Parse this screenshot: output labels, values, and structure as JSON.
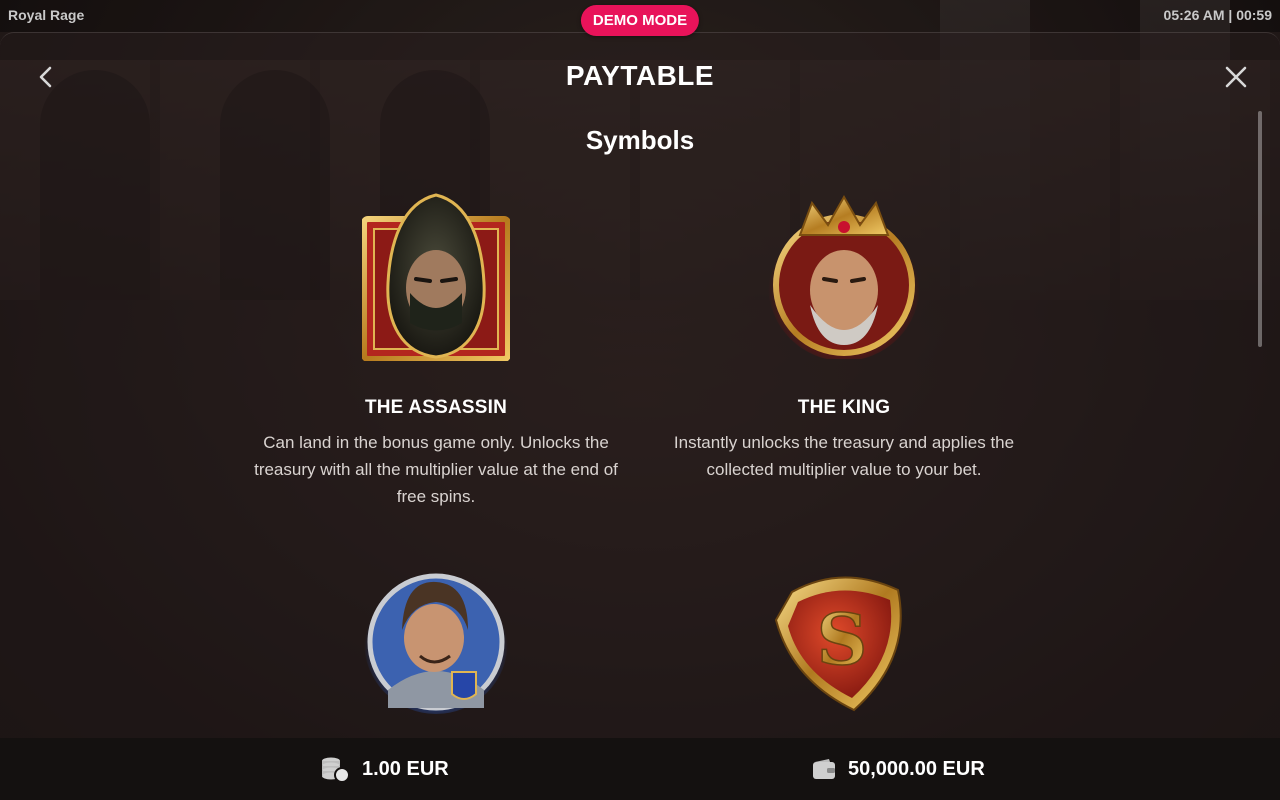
{
  "top_bar": {
    "game_title": "Royal Rage",
    "demo_badge": "DEMO MODE",
    "clock": "05:26 AM | 00:59"
  },
  "panel": {
    "title": "PAYTABLE",
    "section_title": "Symbols"
  },
  "symbols": [
    {
      "name": "THE ASSASSIN",
      "description": "Can land in the bonus game only. Unlocks the treasury with all the multiplier value at the end of free spins.",
      "icon": "assassin-icon"
    },
    {
      "name": "THE KING",
      "description": "Instantly unlocks the treasury and applies the collected multiplier value to your bet.",
      "icon": "king-icon"
    },
    {
      "name": "",
      "description": "",
      "icon": "knight-icon"
    },
    {
      "name": "",
      "description": "",
      "icon": "scatter-shield-icon"
    }
  ],
  "footer": {
    "bet": "1.00 EUR",
    "balance": "50,000.00 EUR",
    "bet_icon": "coins-icon",
    "balance_icon": "wallet-icon"
  },
  "colors": {
    "demo_badge": "#e8135a",
    "footer_bg": "#141110"
  }
}
